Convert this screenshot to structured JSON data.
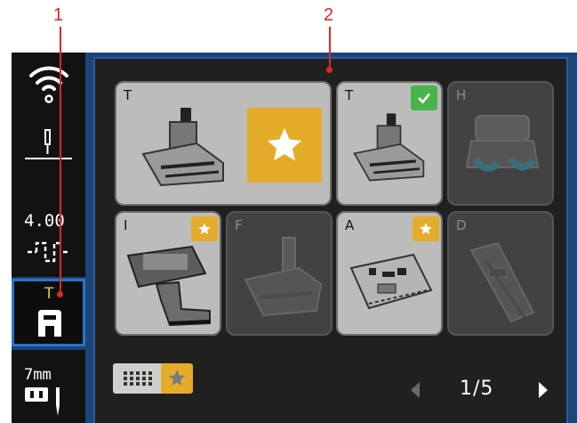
{
  "callouts": [
    "1",
    "2"
  ],
  "sidebar": {
    "wifi_icon": "wifi-icon",
    "needle_icon": "needle-position-icon",
    "stitch_length": "4.00",
    "stitch_icon": "stitch-length-icon",
    "presser_foot_letter": "T",
    "presser_foot_icon": "presser-foot-icon",
    "stitch_width": "7mm",
    "width_icon": "stitch-width-icon"
  },
  "feet": [
    {
      "letter": "T",
      "state": "available",
      "badge": "favorite-star-large"
    },
    {
      "letter": "T",
      "state": "available",
      "badge": "selected-check"
    },
    {
      "letter": "H",
      "state": "unavailable",
      "badge": ""
    },
    {
      "letter": "I",
      "state": "available",
      "badge": "favorite-star"
    },
    {
      "letter": "F",
      "state": "unavailable",
      "badge": ""
    },
    {
      "letter": "A",
      "state": "available",
      "badge": "favorite-star"
    },
    {
      "letter": "D",
      "state": "unavailable",
      "badge": ""
    }
  ],
  "view_toggle": {
    "grid_icon": "grid-view-icon",
    "favorites_icon": "favorites-star-icon"
  },
  "pager": {
    "text": "1/5",
    "prev_icon": "arrow-left-icon",
    "next_icon": "arrow-right-icon"
  },
  "colors": {
    "star": "#e5ac2b",
    "check": "#48b54a",
    "highlight": "#2a73c9",
    "callout": "#e0262a"
  }
}
